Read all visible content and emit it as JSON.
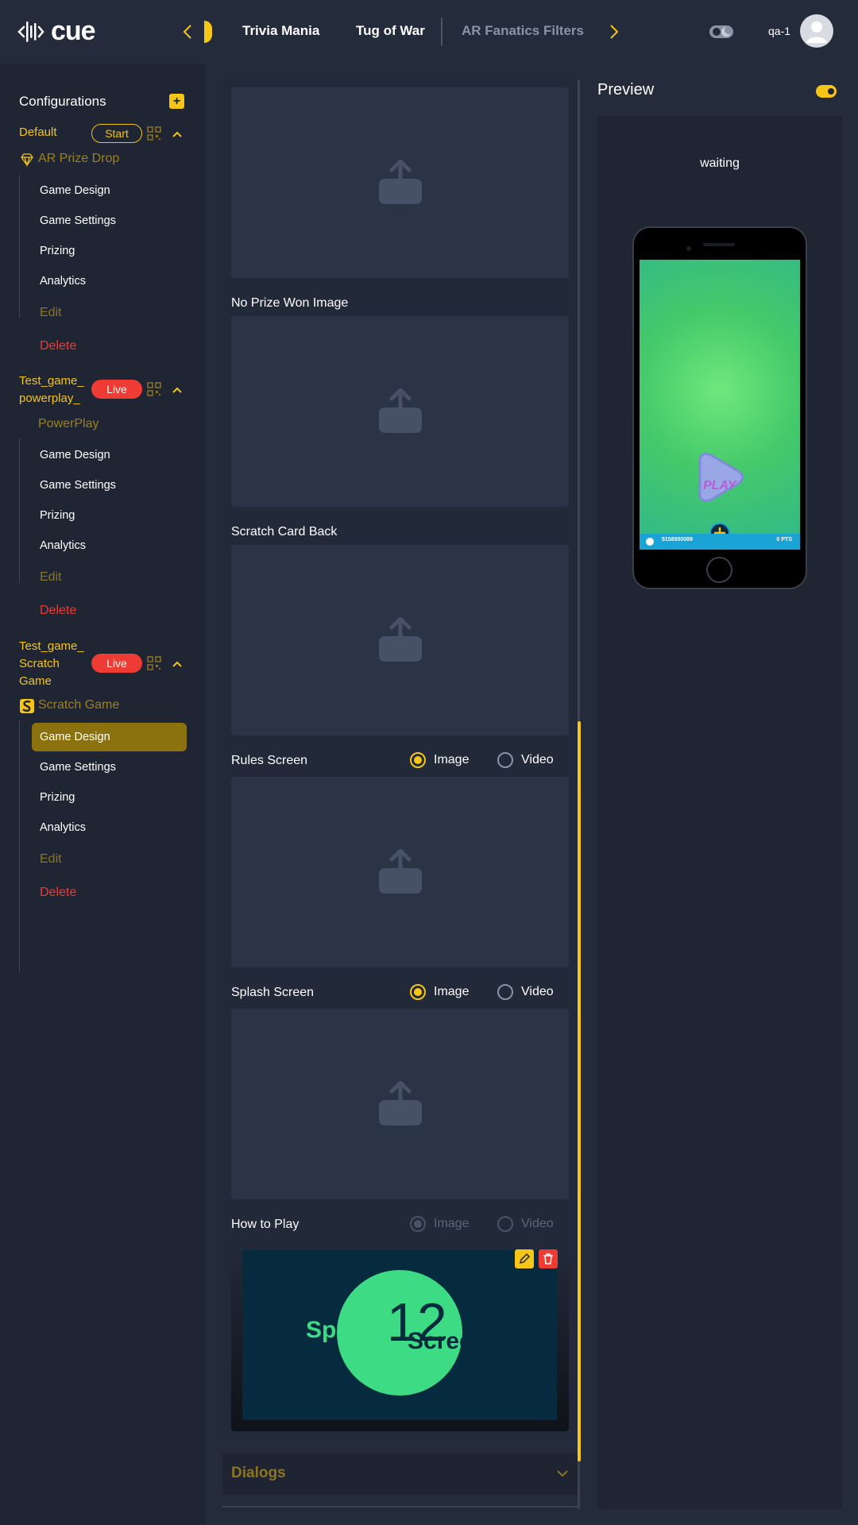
{
  "app": {
    "logo_text": "cue",
    "user_name": "qa-1"
  },
  "tabs": [
    {
      "label": "Trivia Mania"
    },
    {
      "label": "Tug of War"
    },
    {
      "label": "AR Fanatics Filters"
    }
  ],
  "sidebar": {
    "title": "Configurations",
    "groups": [
      {
        "name": "Default",
        "status": "Start",
        "game_type": "AR Prize Drop",
        "items": [
          "Game Design",
          "Game Settings",
          "Prizing",
          "Analytics"
        ],
        "edit": "Edit",
        "delete": "Delete"
      },
      {
        "name_line1": "Test_game_",
        "name_line2": "powerplay_",
        "status": "Live",
        "game_type": "PowerPlay",
        "items": [
          "Game Design",
          "Game Settings",
          "Prizing",
          "Analytics"
        ],
        "edit": "Edit",
        "delete": "Delete"
      },
      {
        "name_line1": "Test_game_",
        "name_line2": "Scratch",
        "name_line3": "Game",
        "status": "Live",
        "game_type": "Scratch Game",
        "items": [
          "Game Design",
          "Game Settings",
          "Prizing",
          "Analytics"
        ],
        "active_item": "Game Design",
        "edit": "Edit",
        "delete": "Delete"
      }
    ]
  },
  "main": {
    "sections": {
      "no_prize": "No Prize Won Image",
      "card_back": "Scratch Card Back",
      "rules": "Rules Screen",
      "splash": "Splash Screen",
      "how_to_play": "How to Play"
    },
    "radio_image": "Image",
    "radio_video": "Video",
    "htp_image_text": {
      "left": "Splash",
      "number": "12",
      "right": "Screen"
    },
    "dialogs": "Dialogs"
  },
  "preview": {
    "title": "Preview",
    "status": "waiting",
    "play_label": "PLAY",
    "phone_left": "5158950089",
    "phone_right": "0 PTS"
  },
  "colors": {
    "accent": "#f5c518",
    "live": "#ee3b34",
    "background": "#242b3a"
  }
}
